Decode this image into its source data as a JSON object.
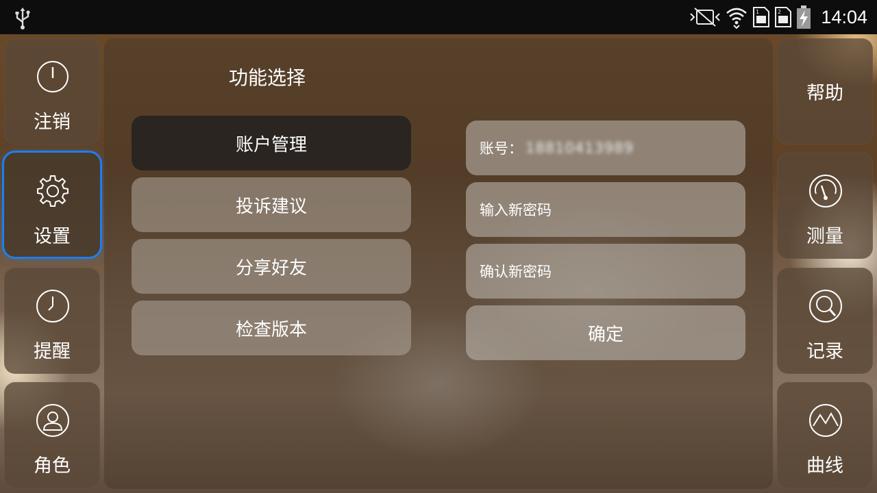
{
  "status_bar": {
    "time": "14:04",
    "icons": [
      "usb-icon",
      "mute-vibrate-icon",
      "wifi-icon",
      "sim1-icon",
      "sim2-icon",
      "battery-charging-icon"
    ]
  },
  "left_nav": [
    {
      "label": "注销",
      "icon": "power-icon"
    },
    {
      "label": "设置",
      "icon": "gear-icon",
      "active": true
    },
    {
      "label": "提醒",
      "icon": "clock-icon"
    },
    {
      "label": "角色",
      "icon": "user-icon"
    }
  ],
  "right_nav": [
    {
      "label": "帮助"
    },
    {
      "label": "测量",
      "icon": "gauge-icon"
    },
    {
      "label": "记录",
      "icon": "search-icon"
    },
    {
      "label": "曲线",
      "icon": "chart-curve-icon"
    }
  ],
  "panel": {
    "title": "功能选择",
    "menu": [
      "账户管理",
      "投诉建议",
      "分享好友",
      "检查版本"
    ],
    "selected_menu": "账户管理",
    "account_label": "账号：",
    "account_value": "18810413989",
    "new_password_placeholder": "输入新密码",
    "confirm_password_placeholder": "确认新密码",
    "confirm_button": "确定"
  },
  "colors": {
    "accent": "#1e7ef0",
    "selected_menu_bg": "#2a2520"
  }
}
